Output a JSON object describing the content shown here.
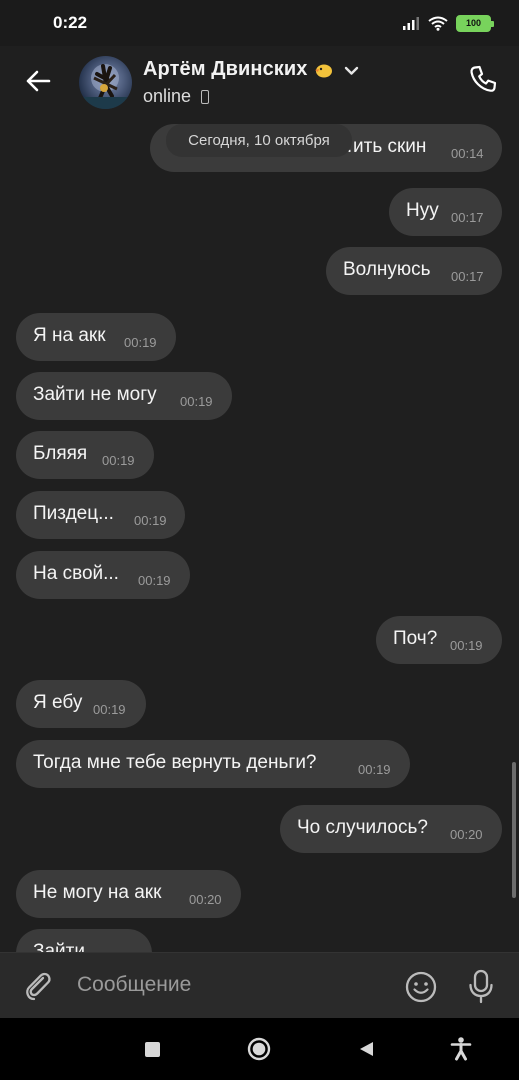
{
  "status_bar": {
    "time": "0:22",
    "battery": "100"
  },
  "header": {
    "contact_name": "Артём Двинских",
    "status": "online"
  },
  "chat": {
    "date_pill": "Сегодня, 10 октября",
    "messages": [
      {
        "text": "…ить скин",
        "time": "00:14",
        "side": "out"
      },
      {
        "text": "Нуу",
        "time": "00:17",
        "side": "out"
      },
      {
        "text": "Волнуюсь",
        "time": "00:17",
        "side": "out"
      },
      {
        "text": "Я на акк",
        "time": "00:19",
        "side": "in"
      },
      {
        "text": "Зайти не могу",
        "time": "00:19",
        "side": "in"
      },
      {
        "text": "Бляяя",
        "time": "00:19",
        "side": "in"
      },
      {
        "text": "Пиздец...",
        "time": "00:19",
        "side": "in"
      },
      {
        "text": "На свой...",
        "time": "00:19",
        "side": "in"
      },
      {
        "text": "Поч?",
        "time": "00:19",
        "side": "out"
      },
      {
        "text": "Я ебу",
        "time": "00:19",
        "side": "in"
      },
      {
        "text": "Тогда мне тебе вернуть деньги?",
        "time": "00:19",
        "side": "in"
      },
      {
        "text": "Чо случилось?",
        "time": "00:20",
        "side": "out"
      },
      {
        "text": "Не могу на акк",
        "time": "00:20",
        "side": "in"
      },
      {
        "text": "Зайти…",
        "time": "",
        "side": "in"
      }
    ]
  },
  "composer": {
    "placeholder": "Сообщение"
  }
}
